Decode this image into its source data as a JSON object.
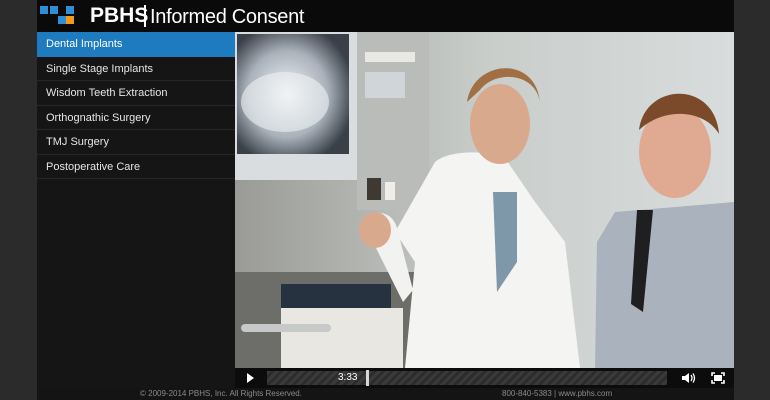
{
  "header": {
    "brand": "PBHS",
    "subtitle": "Informed Consent",
    "logo_colors": [
      "#2e8fd6",
      "#2e8fd6",
      "#2e8fd6",
      "#f39a1e"
    ]
  },
  "sidebar": {
    "items": [
      {
        "label": "Dental Implants",
        "active": true
      },
      {
        "label": "Single Stage Implants",
        "active": false
      },
      {
        "label": "Wisdom Teeth Extraction",
        "active": false
      },
      {
        "label": "Orthognathic Surgery",
        "active": false
      },
      {
        "label": "TMJ Surgery",
        "active": false
      },
      {
        "label": "Postoperative Care",
        "active": false
      }
    ]
  },
  "player": {
    "time": "3:33",
    "play_icon": "play-icon",
    "volume_icon": "volume-icon",
    "fullscreen_icon": "fullscreen-icon"
  },
  "footer": {
    "copyright": "© 2009-2014 PBHS, Inc. All Rights Reserved.",
    "contact": "800-840-5383 | www.pbhs.com"
  },
  "colors": {
    "accent": "#1f7bc0",
    "header_bg": "#0a0a0a",
    "sidebar_bg": "#151515"
  }
}
